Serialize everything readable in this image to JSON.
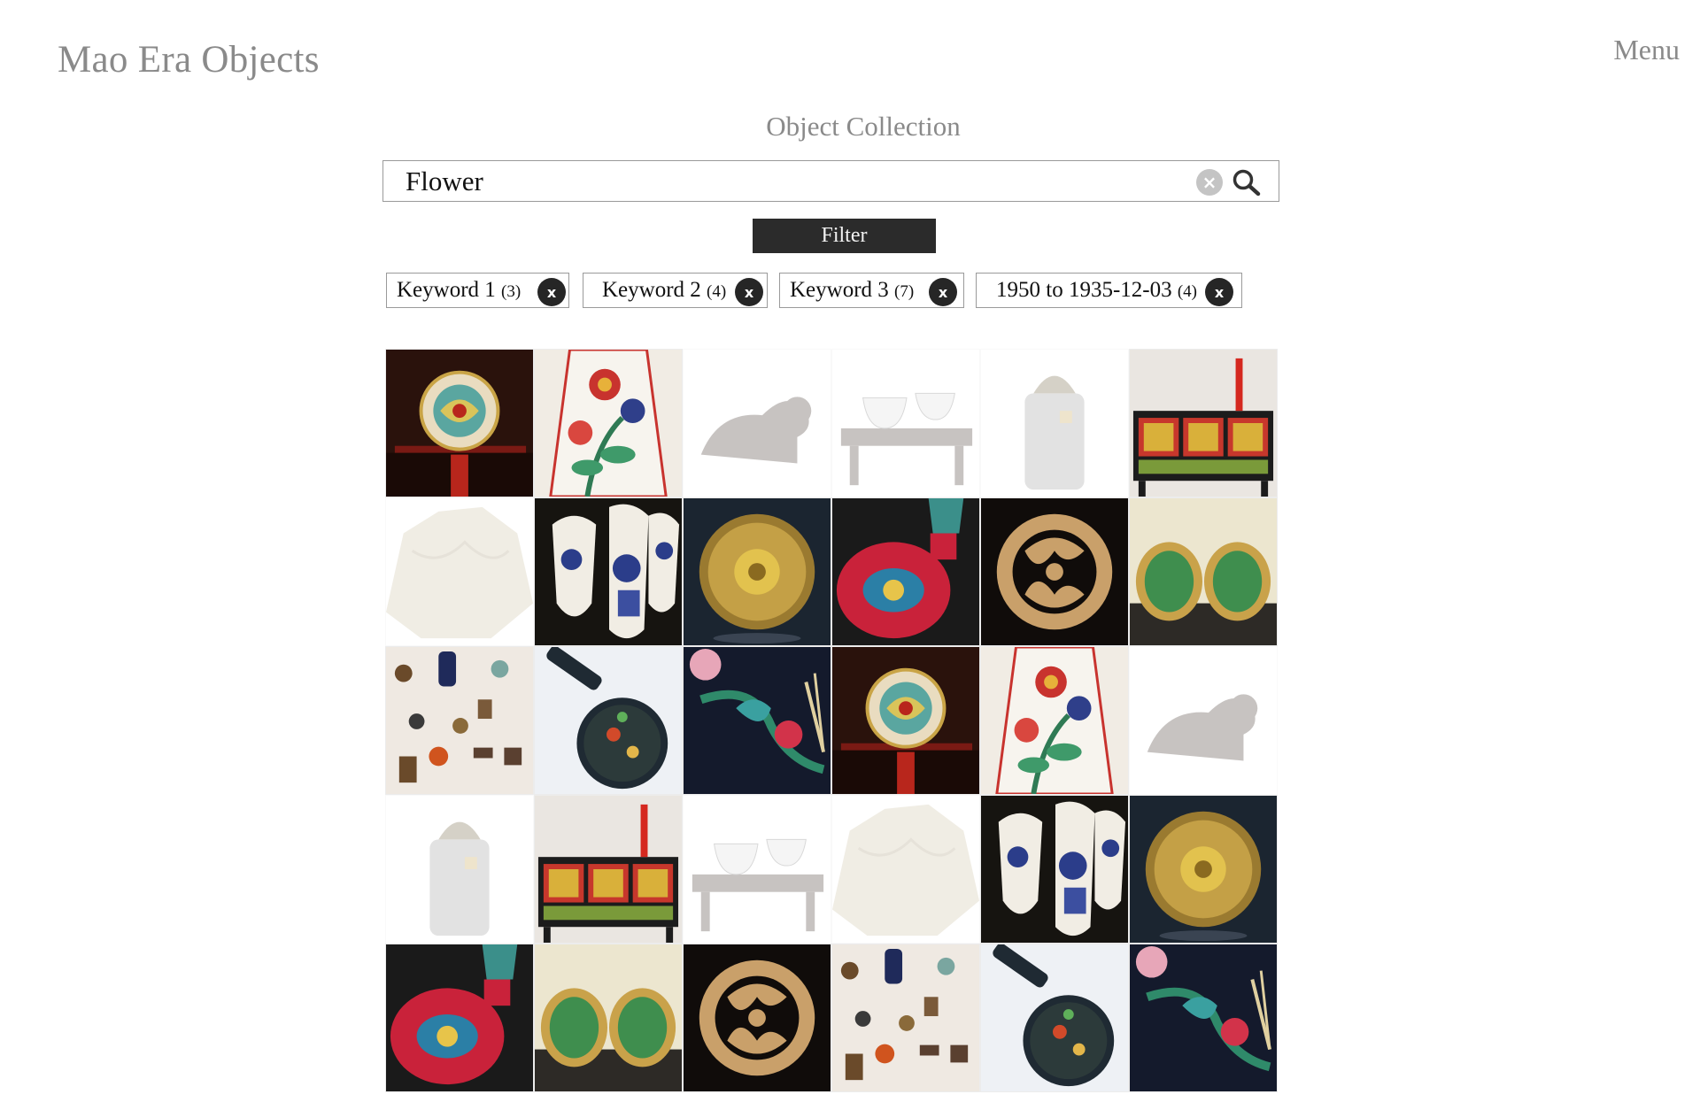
{
  "header": {
    "site_title": "Mao Era Objects",
    "menu_label": "Menu"
  },
  "collection": {
    "title": "Object Collection"
  },
  "search": {
    "value": "Flower",
    "clear_icon": "clear-circle-x-icon",
    "search_icon": "magnifier-icon"
  },
  "filter": {
    "label": "Filter"
  },
  "active_filters": [
    {
      "label": "Keyword  1",
      "count": "(3)",
      "remove": "x"
    },
    {
      "label": "Keyword 2",
      "count": "(4)",
      "remove": "x"
    },
    {
      "label": "Keyword 3",
      "count": "(7)",
      "remove": "x"
    },
    {
      "label": "1950 to 1935-12-03",
      "count": "(4)",
      "remove": "x"
    }
  ],
  "colors": {
    "accent_dark": "#2b2b2b",
    "muted_text": "#8a8a8a",
    "border": "#9a9a9a"
  },
  "grid_items": [
    {
      "subject": "cloisonne-dragon-plate",
      "faded": false
    },
    {
      "subject": "famille-rose-flower-vase-panel",
      "faded": false
    },
    {
      "subject": "bronze-recumbent-animal",
      "faded": true
    },
    {
      "subject": "porcelain-cups-on-stand",
      "faded": true
    },
    {
      "subject": "white-jar-with-figure-lid",
      "faded": true
    },
    {
      "subject": "lacquered-painted-cabinet",
      "faded": false
    },
    {
      "subject": "carved-stone-landscape",
      "faded": true
    },
    {
      "subject": "blue-white-porcelain-spoons",
      "faded": false
    },
    {
      "subject": "gilt-bronze-flower-disc",
      "faded": false
    },
    {
      "subject": "famille-rose-red-vase",
      "faded": false
    },
    {
      "subject": "carved-jade-openwork-disc",
      "faded": false
    },
    {
      "subject": "jade-earrings-in-gold",
      "faded": false
    },
    {
      "subject": "miniature-objects-collection",
      "faded": false
    },
    {
      "subject": "cloisonne-hand-mirror",
      "faded": false
    },
    {
      "subject": "embroidered-phoenix-silk",
      "faded": false
    },
    {
      "subject": "cloisonne-dragon-plate",
      "faded": false
    },
    {
      "subject": "famille-rose-flower-vase-panel",
      "faded": false
    },
    {
      "subject": "bronze-recumbent-animal",
      "faded": true
    },
    {
      "subject": "white-jar-with-figure-lid",
      "faded": true
    },
    {
      "subject": "lacquered-painted-cabinet",
      "faded": false
    },
    {
      "subject": "porcelain-cups-on-stand",
      "faded": true
    },
    {
      "subject": "carved-stone-landscape",
      "faded": true
    },
    {
      "subject": "blue-white-porcelain-spoons",
      "faded": false
    },
    {
      "subject": "gilt-bronze-flower-disc",
      "faded": false
    },
    {
      "subject": "famille-rose-red-vase",
      "faded": false
    },
    {
      "subject": "jade-earrings-in-gold",
      "faded": false
    },
    {
      "subject": "carved-jade-openwork-disc",
      "faded": false
    },
    {
      "subject": "miniature-objects-collection",
      "faded": false
    },
    {
      "subject": "cloisonne-hand-mirror",
      "faded": false
    },
    {
      "subject": "embroidered-phoenix-silk",
      "faded": false
    }
  ]
}
